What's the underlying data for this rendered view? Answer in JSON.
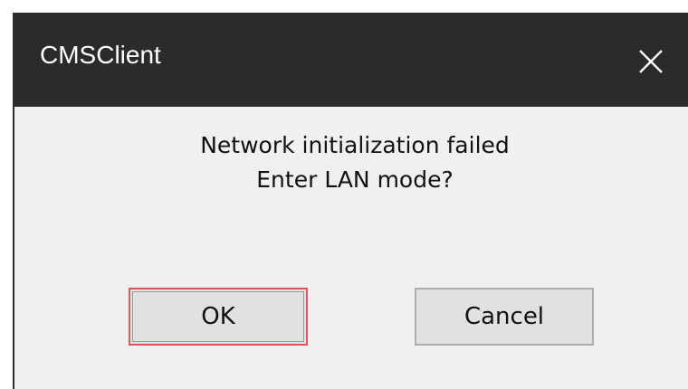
{
  "window": {
    "title": "CMSClient",
    "close_icon": "close-icon"
  },
  "message": {
    "line1": "Network initialization failed",
    "line2": "Enter LAN mode?"
  },
  "buttons": {
    "ok_label": "OK",
    "cancel_label": "Cancel"
  },
  "colors": {
    "titlebar": "#2b2b2b",
    "title_text": "#ffffff",
    "dialog_bg": "#f0f0f0",
    "button_bg": "#e1e1e1",
    "focus_border": "#e0555a"
  }
}
